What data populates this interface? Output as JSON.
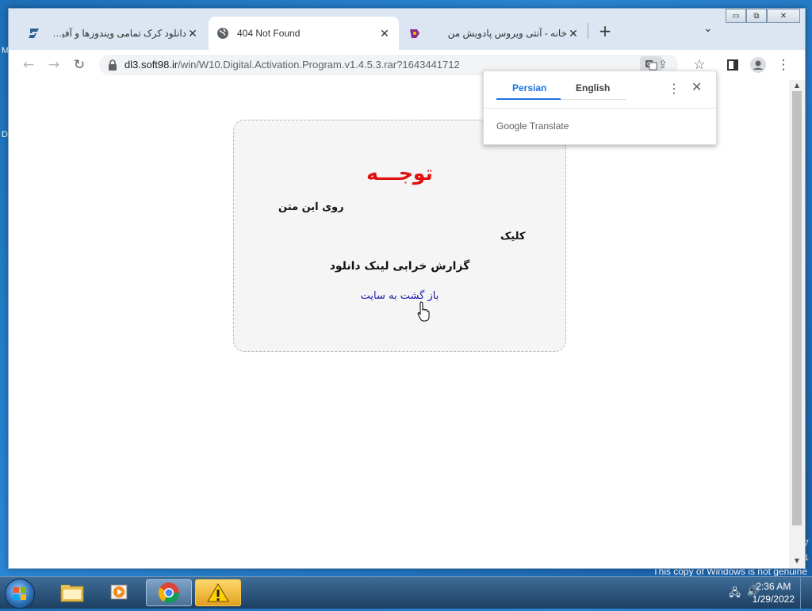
{
  "desktop": {
    "left_edge_text_1": "M",
    "left_edge_text_2": "D",
    "right_edge_text_1": "7",
    "right_edge_text_2": "1",
    "genuine_text": "This copy of Windows is not genuine"
  },
  "window_controls": {
    "minimize": "▭",
    "restore": "⧉",
    "close": "✕"
  },
  "tabs": [
    {
      "title": "دانلود کرک تمامی ویندوزها و آفیس ها آپدیت",
      "icon": "soft98-logo-icon",
      "active": false
    },
    {
      "title": "404 Not Found",
      "icon": "globe-icon",
      "active": true
    },
    {
      "title": "خانه - آنتی ویروس پادویش من",
      "icon": "padvish-icon",
      "active": false
    }
  ],
  "browser": {
    "new_tab": "+",
    "tab_search": "⌄",
    "back": "←",
    "forward": "→",
    "reload": "↻",
    "url_host": "dl3.soft98.ir",
    "url_path": "/win/W10.Digital.Activation.Program.v1.4.5.3.rar?1643441712",
    "bookmark": "☆",
    "menu": "⋮"
  },
  "page": {
    "notice_title": "توجـــه",
    "line1": "روی این متن",
    "line2": "کلیک",
    "line3": "گزارش خرابی لینک دانلود",
    "back_link": "باز گشت به سایت"
  },
  "translate_popup": {
    "tab_source": "Persian",
    "tab_target": "English",
    "menu": "⋮",
    "close": "✕",
    "footer_google": "Google",
    "footer_translate": "Translate"
  },
  "taskbar": {
    "clock_time": "2:36 AM",
    "clock_date": "1/29/2022"
  },
  "colors": {
    "notice_title": "#e01010",
    "link": "#1a1aa8",
    "accent": "#1a73e8"
  }
}
